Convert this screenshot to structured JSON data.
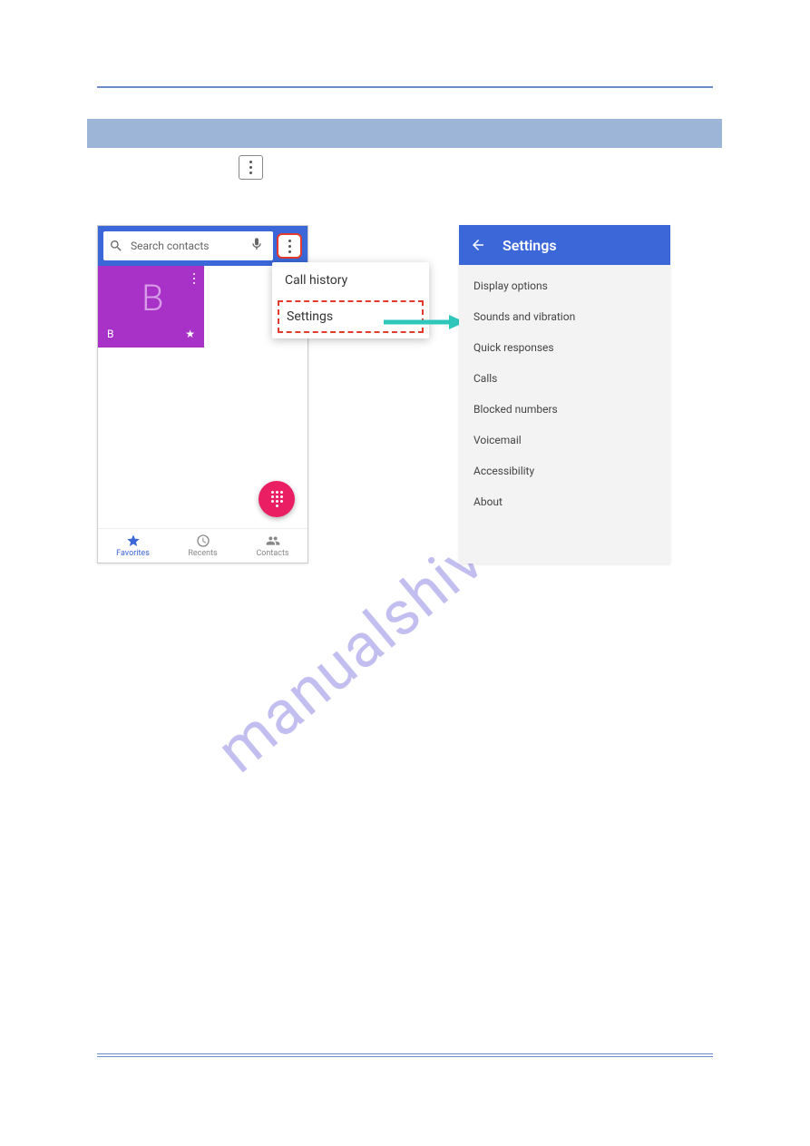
{
  "watermark": "manualshive.com",
  "phone_left": {
    "search_placeholder": "Search contacts",
    "contact_big_letter": "B",
    "contact_small_letter": "B",
    "tabs": [
      {
        "label": "Favorites",
        "icon": "star",
        "active": true
      },
      {
        "label": "Recents",
        "icon": "clock",
        "active": false
      },
      {
        "label": "Contacts",
        "icon": "people",
        "active": false
      }
    ]
  },
  "popup": {
    "items": [
      {
        "label": "Call history",
        "emph": false
      },
      {
        "label": "Settings",
        "emph": true
      }
    ]
  },
  "settings_panel": {
    "title": "Settings",
    "items": [
      "Display options",
      "Sounds and vibration",
      "Quick responses",
      "Calls",
      "Blocked numbers",
      "Voicemail",
      "Accessibility",
      "About"
    ]
  }
}
